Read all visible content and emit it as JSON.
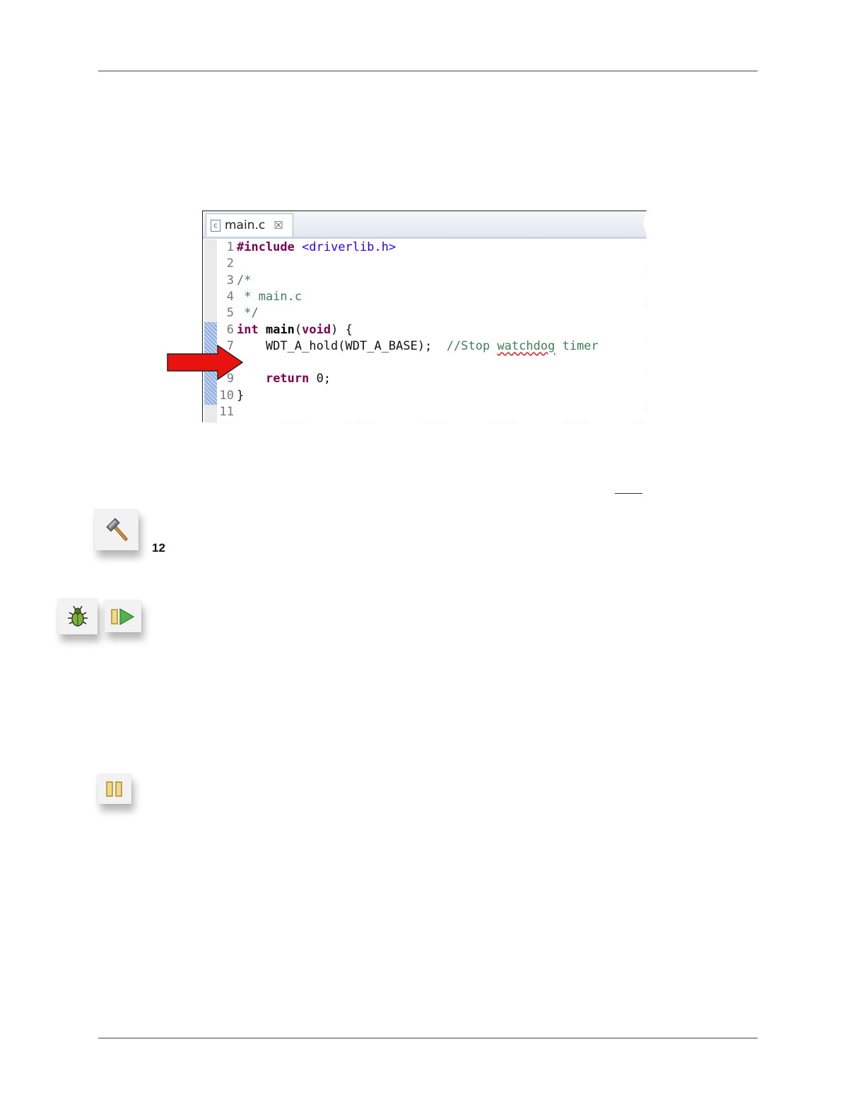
{
  "editor": {
    "tab_icon": "c",
    "tab_label": "main.c",
    "tab_close": "☒",
    "lines": [
      {
        "num": "1",
        "parts": [
          {
            "t": "#include",
            "c": "kw"
          },
          {
            "t": " ",
            "c": ""
          },
          {
            "t": "<driverlib.h>",
            "c": "str"
          }
        ]
      },
      {
        "num": "2",
        "parts": []
      },
      {
        "num": "3",
        "parts": [
          {
            "t": "/*",
            "c": "cm"
          }
        ]
      },
      {
        "num": "4",
        "parts": [
          {
            "t": " * main.c",
            "c": "cm"
          }
        ]
      },
      {
        "num": "5",
        "parts": [
          {
            "t": " */",
            "c": "cm"
          }
        ]
      },
      {
        "num": "6",
        "parts": [
          {
            "t": "int",
            "c": "kw"
          },
          {
            "t": " ",
            "c": ""
          },
          {
            "t": "main",
            "c": "fn"
          },
          {
            "t": "(",
            "c": ""
          },
          {
            "t": "void",
            "c": "kw"
          },
          {
            "t": ") {",
            "c": ""
          }
        ]
      },
      {
        "num": "7",
        "parts": [
          {
            "t": "    WDT_A_hold(WDT_A_BASE);  ",
            "c": ""
          },
          {
            "t": "//Stop ",
            "c": "cm"
          },
          {
            "t": "watchdog",
            "c": "cm squiggle"
          },
          {
            "t": " timer",
            "c": "cm"
          }
        ]
      },
      {
        "num": "8",
        "parts": []
      },
      {
        "num": "9",
        "parts": [
          {
            "t": "    ",
            "c": ""
          },
          {
            "t": "return",
            "c": "kw"
          },
          {
            "t": " 0;",
            "c": ""
          }
        ]
      },
      {
        "num": "10",
        "parts": [
          {
            "t": "}",
            "c": ""
          }
        ]
      },
      {
        "num": "11",
        "parts": []
      }
    ]
  },
  "step_number": "12",
  "icons": {
    "build": "hammer-icon",
    "debug": "bug-icon",
    "resume": "resume-icon",
    "suspend": "suspend-icon"
  },
  "colors": {
    "arrow": "#e8130f",
    "keyword": "#7f0055",
    "string": "#2a00ff",
    "comment": "#3f7f5f"
  }
}
